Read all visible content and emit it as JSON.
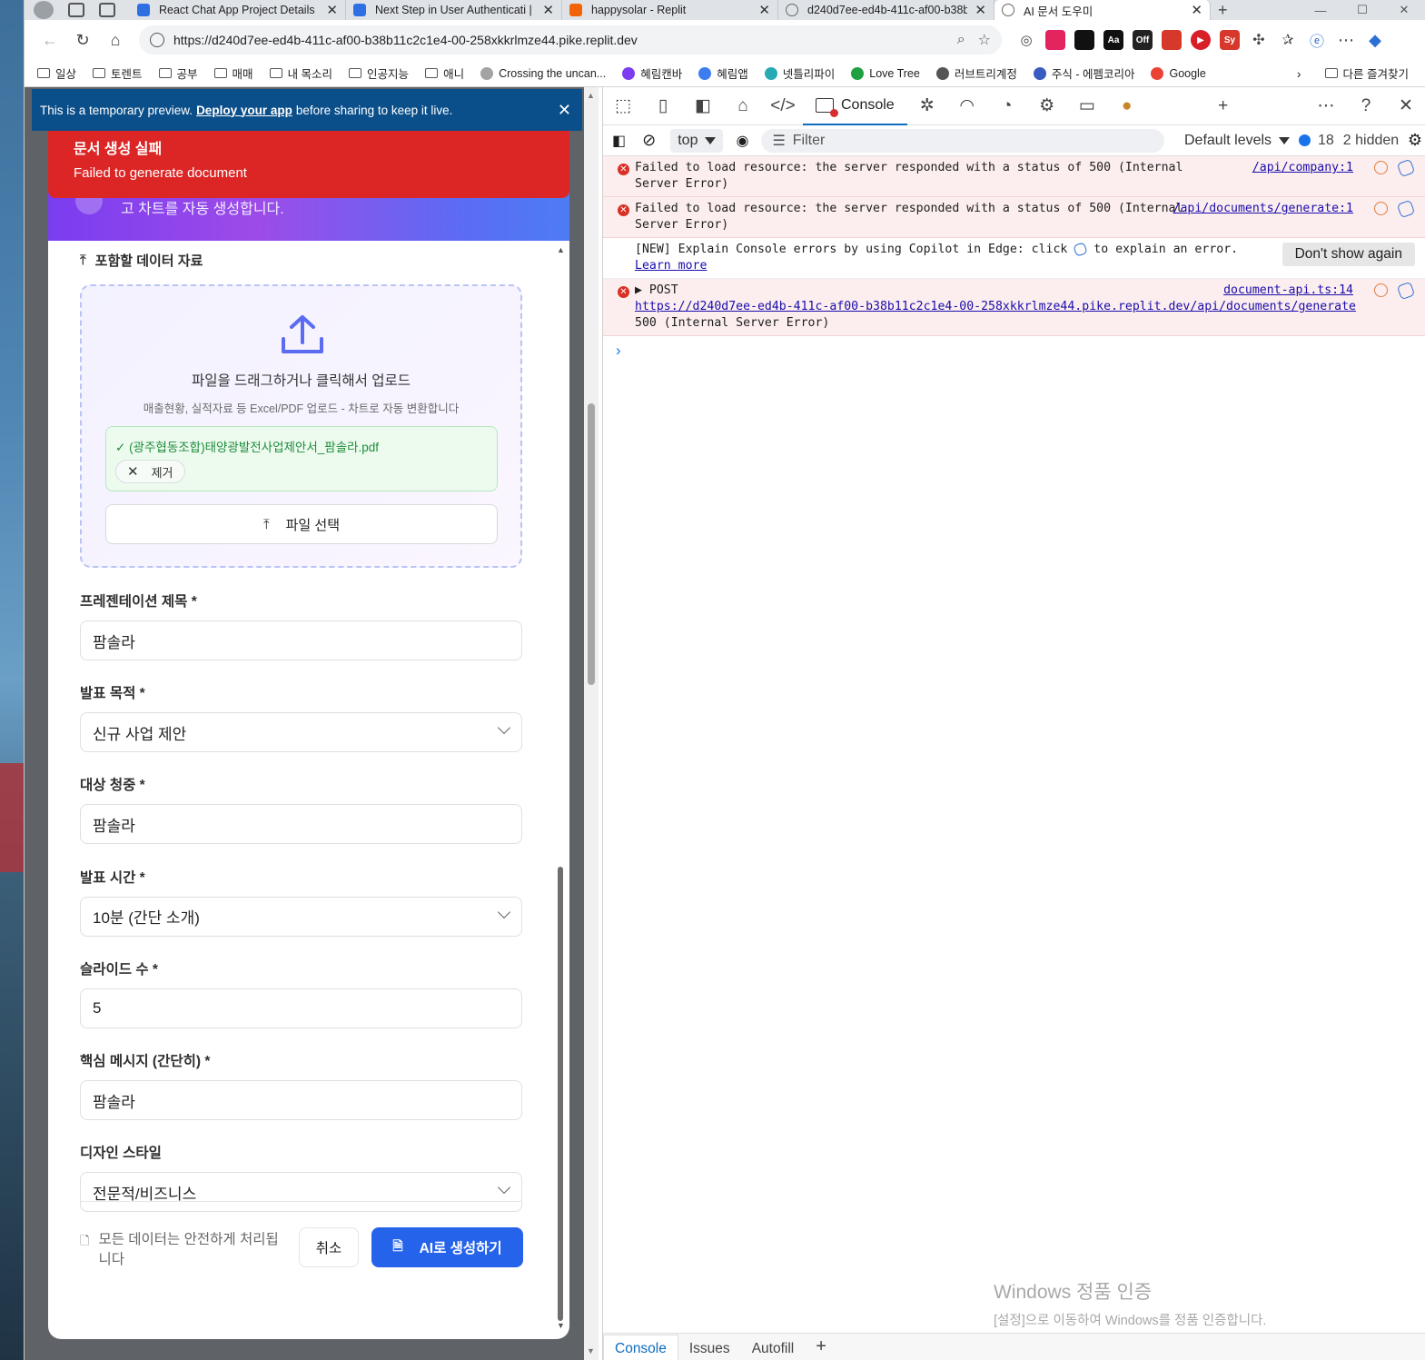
{
  "browser": {
    "tabs": [
      {
        "title": "React Chat App Project Details | G",
        "favicon": "#2f6fe4"
      },
      {
        "title": "Next Step in User Authenticati | G",
        "favicon": "#2f6fe4"
      },
      {
        "title": "happysolar - Replit",
        "favicon": "#f26207"
      },
      {
        "title": "d240d7ee-ed4b-411c-af00-b38b",
        "favicon": "#888888"
      },
      {
        "title": "AI 문서 도우미",
        "favicon": "#888888"
      }
    ],
    "url": "https://d240d7ee-ed4b-411c-af00-b38b11c2c1e4-00-258xkkrlmze44.pike.replit.dev",
    "extensions": [
      {
        "label": "",
        "color": "#e2245f"
      },
      {
        "label": "",
        "color": "#111111"
      },
      {
        "label": "Aa",
        "color": "#111111"
      },
      {
        "label": "Off",
        "color": "#222222"
      },
      {
        "label": "",
        "color": "#d6392c"
      },
      {
        "label": "▶",
        "color": "#d61f26"
      },
      {
        "label": "Sy",
        "color": "#d6392c"
      }
    ],
    "bookmarks": [
      {
        "label": "일상",
        "type": "folder"
      },
      {
        "label": "토렌트",
        "type": "folder"
      },
      {
        "label": "공부",
        "type": "folder"
      },
      {
        "label": "매매",
        "type": "folder"
      },
      {
        "label": "내 목소리",
        "type": "folder"
      },
      {
        "label": "인공지능",
        "type": "folder"
      },
      {
        "label": "애니",
        "type": "folder"
      },
      {
        "label": "Crossing the uncan...",
        "type": "site",
        "color": "#a3a3a3"
      },
      {
        "label": "혜림캔바",
        "type": "site",
        "color": "#7d3cf0"
      },
      {
        "label": "혜림앱",
        "type": "site",
        "color": "#3c7df0"
      },
      {
        "label": "넷틀리파이",
        "type": "site",
        "color": "#27aab5"
      },
      {
        "label": "Love Tree",
        "type": "site",
        "color": "#20a040"
      },
      {
        "label": "러브트리계정",
        "type": "site",
        "color": "#555555"
      },
      {
        "label": "주식 - 에펨코리아",
        "type": "site",
        "color": "#3a5bc0"
      },
      {
        "label": "Google",
        "type": "site",
        "color": "#ea4335"
      }
    ],
    "other_bookmarks": "다른 즐겨찾기"
  },
  "preview_banner": {
    "prefix": "This is a temporary preview.",
    "link": "Deploy your app",
    "suffix": "before sharing to keep it live."
  },
  "toast": {
    "title": "문서 생성 실패",
    "message": "Failed to generate document"
  },
  "modal": {
    "header_hint": "고 차트를 자동 생성합니다.",
    "data_section_title": "포함할 데이터 자료",
    "dropzone_main": "파일을 드래그하거나 클릭해서 업로드",
    "dropzone_sub": "매출현황, 실적자료 등 Excel/PDF 업로드 - 차트로 자동 변환합니다",
    "uploaded_file": "(광주협동조합)태양광발전사업제안서_팜솔라.pdf",
    "remove_label": "제거",
    "choose_file_label": "파일 선택",
    "fields": [
      {
        "label": "프레젠테이션 제목 *",
        "value": "팜솔라",
        "type": "input"
      },
      {
        "label": "발표 목적 *",
        "value": "신규 사업 제안",
        "type": "select"
      },
      {
        "label": "대상 청중 *",
        "value": "팜솔라",
        "type": "input"
      },
      {
        "label": "발표 시간 *",
        "value": "10분 (간단 소개)",
        "type": "select"
      },
      {
        "label": "슬라이드 수 *",
        "value": "5",
        "type": "input"
      },
      {
        "label": "핵심 메시지 (간단히) *",
        "value": "팜솔라",
        "type": "input"
      },
      {
        "label": "디자인 스타일",
        "value": "전문적/비즈니스",
        "type": "select"
      }
    ],
    "footer_note": "모든 데이터는 안전하게 처리됩니다",
    "cancel_label": "취소",
    "generate_label": "AI로 생성하기"
  },
  "devtools": {
    "console_tab": "Console",
    "context": "top",
    "filter_placeholder": "Filter",
    "levels": "Default levels",
    "message_count": "18",
    "hidden": "2 hidden",
    "messages": [
      {
        "kind": "error",
        "text": "Failed to load resource: the server responded with a status of 500 (Internal Server Error)",
        "source": "/api/company:1"
      },
      {
        "kind": "error",
        "text": "Failed to load resource: the server responded with a status of 500 (Internal Server Error)",
        "source": "/api/documents/generate:1"
      }
    ],
    "copilot_text": "[NEW] Explain Console errors by using Copilot in Edge: click",
    "copilot_text2": "to explain an error.",
    "learn_more": "Learn more",
    "dont_show": "Don't show again",
    "post_error": {
      "method": "POST",
      "source": "document-api.ts:14",
      "url": "https://d240d7ee-ed4b-411c-af00-b38b11c2c1e4-00-258xkkrlmze44.pike.replit.dev/api/documents/generate",
      "status": "500 (Internal Server Error)"
    },
    "watermark_title": "Windows 정품 인증",
    "watermark_sub": "[설정]으로 이동하여 Windows를 정품 인증합니다.",
    "drawer_tabs": [
      "Console",
      "Issues",
      "Autofill"
    ]
  }
}
